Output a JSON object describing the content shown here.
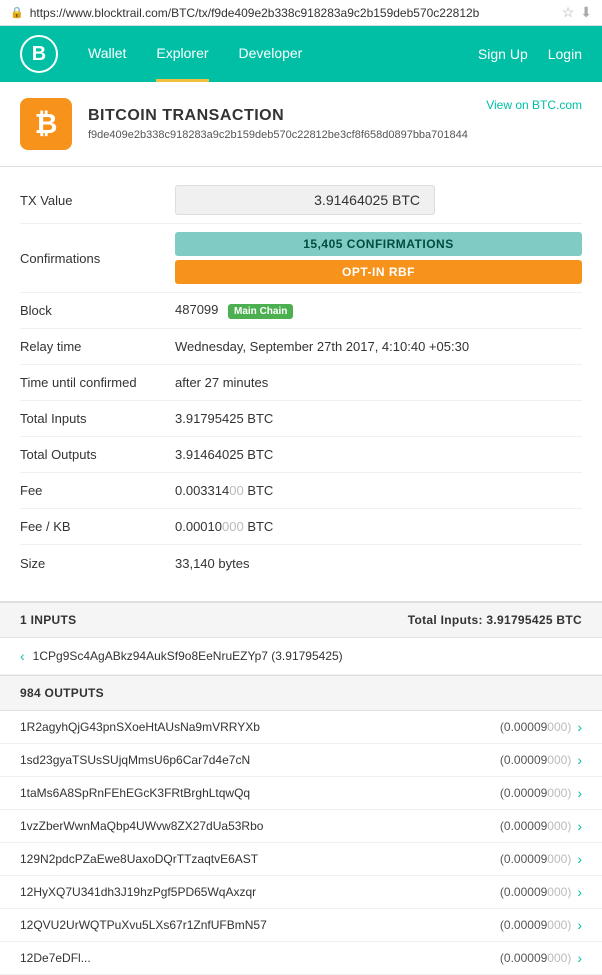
{
  "urlBar": {
    "lock": "🔒",
    "url": "https://www.blocktrail.com/BTC/tx/f9de409e2b338c918283a9c2b159deb570c22812b",
    "star": "☆",
    "dl": "⬇"
  },
  "header": {
    "logo": "B",
    "nav": [
      {
        "label": "Wallet",
        "active": false
      },
      {
        "label": "Explorer",
        "active": true
      },
      {
        "label": "Developer",
        "active": false
      }
    ],
    "auth": [
      {
        "label": "Sign Up"
      },
      {
        "label": "Login"
      }
    ]
  },
  "transaction": {
    "icon": "₿",
    "title": "BITCOIN TRANSACTION",
    "viewOnBTC": "View on BTC.com",
    "hash": "f9de409e2b338c918283a9c2b159deb570c22812be3cf8f658d0897bba701844",
    "details": [
      {
        "label": "TX Value",
        "type": "box",
        "value": "3.91464025 BTC"
      },
      {
        "label": "Confirmations",
        "type": "confirmations",
        "conf": "15,405 CONFIRMATIONS",
        "rbf": "OPT-IN RBF"
      },
      {
        "label": "Block",
        "type": "block",
        "number": "487099",
        "badge": "Main Chain"
      },
      {
        "label": "Relay time",
        "type": "text",
        "value": "Wednesday, September 27th 2017, 4:10:40 +05:30"
      },
      {
        "label": "Time until confirmed",
        "type": "text",
        "value": "after 27 minutes"
      },
      {
        "label": "Total Inputs",
        "type": "text",
        "value": "3.91795425 BTC"
      },
      {
        "label": "Total Outputs",
        "type": "text",
        "value": "3.91464025 BTC"
      },
      {
        "label": "Fee",
        "type": "fee",
        "value": "0.0033140",
        "zeros": "0",
        "suffix": " BTC"
      },
      {
        "label": "Fee / KB",
        "type": "fee",
        "value": "0.00010",
        "zeros": "000",
        "suffix": " BTC"
      },
      {
        "label": "Size",
        "type": "text",
        "value": "33,140 bytes"
      }
    ]
  },
  "inputs": {
    "header": "1 INPUTS",
    "totalLabel": "Total Inputs: 3.91795425 BTC",
    "items": [
      {
        "address": "1CPg9Sc4AgABkz94AukSf9o8EeNruEZYp7",
        "amount": "(3.91795425)"
      }
    ]
  },
  "outputs": {
    "header": "984 OUTPUTS",
    "items": [
      {
        "address": "1R2agyhQjG43pnSXoeHtAUsNa9mVRRYXb",
        "amount": "(0.00009",
        "zeros": "000)"
      },
      {
        "address": "1sd23gyaTSUsSUjqMmsU6p6Car7d4e7cN",
        "amount": "(0.00009",
        "zeros": "000)"
      },
      {
        "address": "1taMs6A8SpRnFEhEGcK3FRtBrghLtqwQq",
        "amount": "(0.00009",
        "zeros": "000)"
      },
      {
        "address": "1vzZberWwnMaQbp4UWvw8ZX27dUa53Rbo",
        "amount": "(0.00009",
        "zeros": "000)"
      },
      {
        "address": "129N2pdcPZaEwe8UaxoDQrTTzaqtvE6AST",
        "amount": "(0.00009",
        "zeros": "000)"
      },
      {
        "address": "12HyXQ7U341dh3J19hzPgf5PD65WqAxzqr",
        "amount": "(0.00009",
        "zeros": "000)"
      },
      {
        "address": "12QVU2UrWQTPuXvu5LXs67r1ZnfUFBmN57",
        "amount": "(0.00009",
        "zeros": "000)"
      },
      {
        "address": "12De7eDFl...",
        "amount": "(0.00009",
        "zeros": "000)"
      }
    ]
  }
}
